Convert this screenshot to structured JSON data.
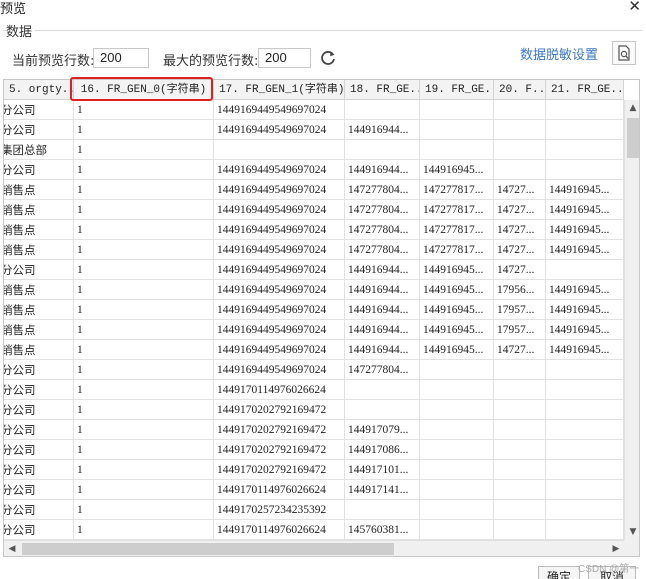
{
  "window": {
    "title": "预览",
    "close_glyph": "✕"
  },
  "group": {
    "label": "数据"
  },
  "toolbar": {
    "current_rows_label": "当前预览行数:",
    "current_rows_value": "200",
    "max_rows_label": "最大的预览行数:",
    "max_rows_value": "200",
    "refresh_icon": "refresh-icon",
    "mask_link": "数据脱敏设置",
    "preview_icon": "document-search-icon"
  },
  "table": {
    "columns": [
      "5. orgty...",
      "16. FR_GEN_0(字符串)",
      "17. FR_GEN_1(字符串)",
      "18. FR_GE...",
      "19. FR_GE...",
      "20. F...",
      "21. FR_GE..."
    ],
    "rows": [
      [
        "分公司",
        "1",
        "1449169449549697024",
        "",
        "",
        "",
        ""
      ],
      [
        "分公司",
        "1",
        "1449169449549697024",
        "144916944...",
        "",
        "",
        ""
      ],
      [
        "集团总部",
        "1",
        "",
        "",
        "",
        "",
        ""
      ],
      [
        "分公司",
        "1",
        "1449169449549697024",
        "144916944...",
        "144916945...",
        "",
        ""
      ],
      [
        "销售点",
        "1",
        "1449169449549697024",
        "147277804...",
        "147277817...",
        "14727...",
        "144916945..."
      ],
      [
        "销售点",
        "1",
        "1449169449549697024",
        "147277804...",
        "147277817...",
        "14727...",
        "144916945..."
      ],
      [
        "销售点",
        "1",
        "1449169449549697024",
        "147277804...",
        "147277817...",
        "14727...",
        "144916945..."
      ],
      [
        "销售点",
        "1",
        "1449169449549697024",
        "147277804...",
        "147277817...",
        "14727...",
        "144916945..."
      ],
      [
        "分公司",
        "1",
        "1449169449549697024",
        "144916944...",
        "144916945...",
        "14727...",
        ""
      ],
      [
        "销售点",
        "1",
        "1449169449549697024",
        "144916944...",
        "144916945...",
        "17956...",
        "144916945..."
      ],
      [
        "销售点",
        "1",
        "1449169449549697024",
        "144916944...",
        "144916945...",
        "17957...",
        "144916945..."
      ],
      [
        "销售点",
        "1",
        "1449169449549697024",
        "144916944...",
        "144916945...",
        "17957...",
        "144916945..."
      ],
      [
        "销售点",
        "1",
        "1449169449549697024",
        "144916944...",
        "144916945...",
        "14727...",
        "144916945..."
      ],
      [
        "分公司",
        "1",
        "1449169449549697024",
        "147277804...",
        "",
        "",
        ""
      ],
      [
        "分公司",
        "1",
        "1449170114976026624",
        "",
        "",
        "",
        ""
      ],
      [
        "分公司",
        "1",
        "1449170202792169472",
        "",
        "",
        "",
        ""
      ],
      [
        "分公司",
        "1",
        "1449170202792169472",
        "144917079...",
        "",
        "",
        ""
      ],
      [
        "分公司",
        "1",
        "1449170202792169472",
        "144917086...",
        "",
        "",
        ""
      ],
      [
        "分公司",
        "1",
        "1449170202792169472",
        "144917101...",
        "",
        "",
        ""
      ],
      [
        "分公司",
        "1",
        "1449170114976026624",
        "144917141...",
        "",
        "",
        ""
      ],
      [
        "分公司",
        "1",
        "1449170257234235392",
        "",
        "",
        "",
        ""
      ],
      [
        "分公司",
        "1",
        "1449170114976026624",
        "145760381...",
        "",
        "",
        ""
      ]
    ]
  },
  "footer": {
    "ok_label": "确定",
    "cancel_label": "取消",
    "watermark": "CSDN @第一"
  },
  "colors": {
    "highlight_border": "#e0201f",
    "link": "#3a78c9"
  }
}
